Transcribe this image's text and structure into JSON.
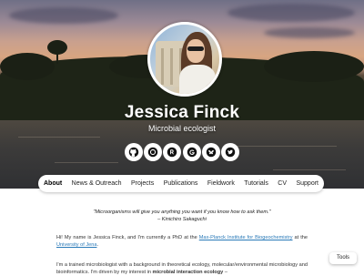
{
  "profile": {
    "name": "Jessica Finck",
    "subtitle": "Microbial ecologist"
  },
  "socials": [
    {
      "icon": "github-icon"
    },
    {
      "icon": "orcid-icon"
    },
    {
      "icon": "researchgate-icon"
    },
    {
      "icon": "google-scholar-icon"
    },
    {
      "icon": "bluesky-butterfly-icon"
    },
    {
      "icon": "twitter-bird-icon"
    }
  ],
  "nav": {
    "items": [
      "About",
      "News & Outreach",
      "Projects",
      "Publications",
      "Fieldwork",
      "Tutorials",
      "CV",
      "Support"
    ],
    "active": "About"
  },
  "content": {
    "quote": "\"Microorganisms will give you anything you want if you know how to ask them.\"",
    "quote_author": "– Kinichiro Sakaguchi",
    "p1_start": "Hi! My name is Jessica Finck, and I'm currently a PhD at the",
    "p1_link1": "Max-Planck Institute for Biogeochemistry",
    "p1_mid": "at the",
    "p1_link2": "University of Jena",
    "p1_end": ".",
    "p2_start": "I'm a trained microbiologist with a background in theoretical ecology, molecular/environmental microbiology and bioinformatics. I'm driven by my interest in",
    "p2_bold": "microbial interaction ecology",
    "p2_end": "–"
  },
  "tools_button": "Tools",
  "colors": {
    "link": "#2a7ab8",
    "nav_bg": "#ffffff"
  }
}
